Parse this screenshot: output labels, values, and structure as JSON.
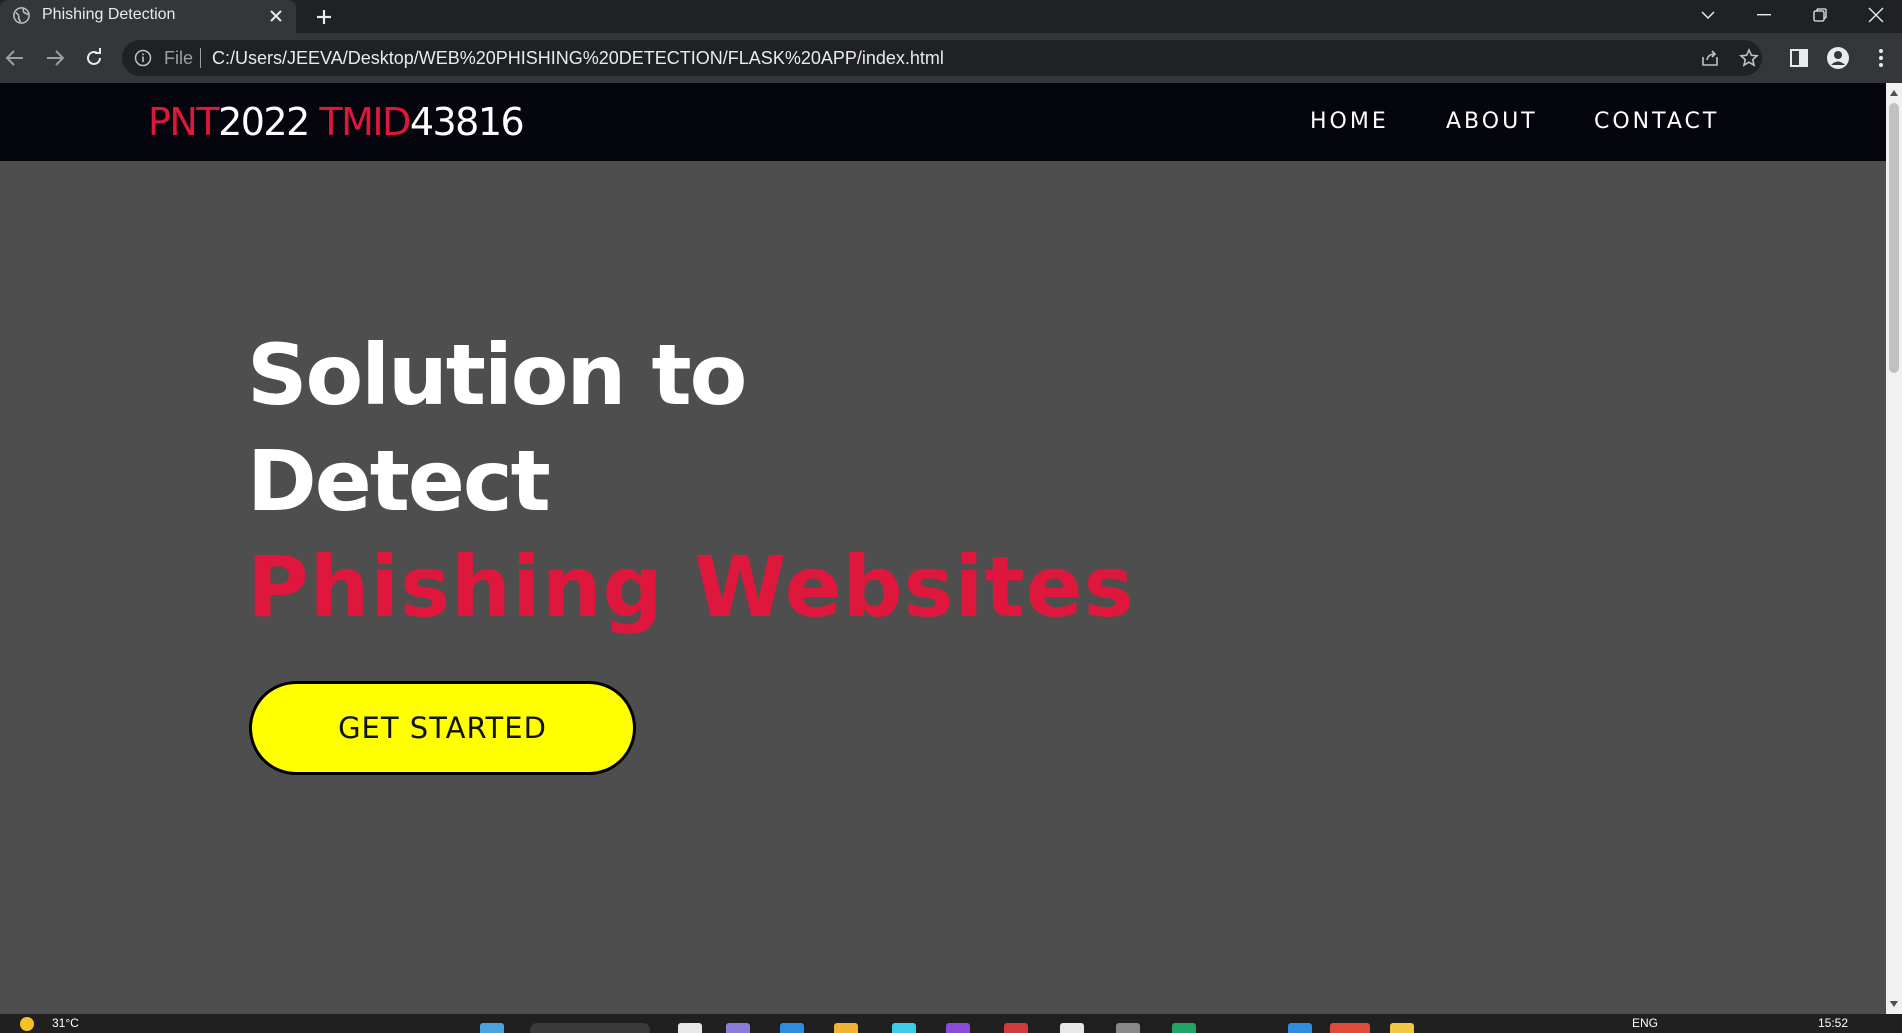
{
  "browser": {
    "tab_title": "Phishing Detection",
    "address_scheme": "File",
    "address_url": "C:/Users/JEEVA/Desktop/WEB%20PHISHING%20DETECTION/FLASK%20APP/index.html"
  },
  "navbar": {
    "brand_part1": "PNT",
    "brand_part2": "2022 ",
    "brand_part3": "TMID",
    "brand_part4": "43816",
    "links": [
      "HOME",
      "ABOUT",
      "CONTACT"
    ]
  },
  "hero": {
    "line1": "Solution to",
    "line2": "Detect",
    "line3": "Phishing Websites",
    "cta_label": "GET STARTED"
  },
  "taskbar": {
    "temperature": "31°C",
    "language": "ENG",
    "time": "15:52"
  },
  "colors": {
    "accent_red": "#e0173c",
    "cta_yellow": "#ffff00",
    "page_bg": "#4e4e4e",
    "navbar_bg": "#05050d"
  }
}
